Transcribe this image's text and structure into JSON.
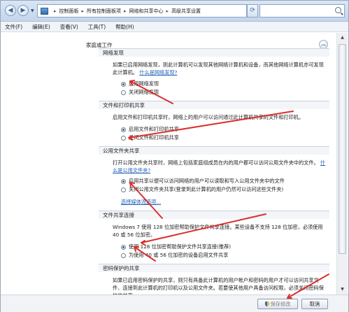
{
  "breadcrumbs": [
    "控制面板",
    "所有控制面板项",
    "网络和共享中心",
    "高级共享设置"
  ],
  "menu": [
    "文件(F)",
    "编辑(E)",
    "查看(V)",
    "工具(T)",
    "帮助(H)"
  ],
  "profile": {
    "title": "家庭或工作",
    "collapse_glyph": "︽"
  },
  "sections": {
    "discovery": {
      "title": "网络发现",
      "desc": "如果已启用网络发现，则此计算机可以发现其他网络计算机和设备，而其他网络计算机亦可发现此计算机。",
      "link": "什么是网络发现?",
      "options": [
        "启用网络发现",
        "关闭网络发现"
      ]
    },
    "file_printer": {
      "title": "文件和打印机共享",
      "desc": "启用文件和打印机共享时，网络上的用户可以访问通过此计算机共享的文件和打印机。",
      "options": [
        "启用文件和打印机共享",
        "关闭文件和打印机共享"
      ]
    },
    "public_folder": {
      "title": "公用文件夹共享",
      "desc": "打开公用文件夹共享时，网络上包括家庭组成员在内的用户都可以访问公用文件夹中的文件。",
      "link": "什么是公用文件夹?",
      "options": [
        "启用共享以便可以访问网络的用户可以读取和写入公用文件夹中的文件",
        "关闭公用文件夹共享(登录到此计算机的用户仍然可以访问这些文件夹)"
      ],
      "media_link": "选择媒体流选项..."
    },
    "connection": {
      "title": "文件共享连接",
      "desc": "Windows 7 使用 128 位加密帮助保护文件共享连接。某些设备不支持 128 位加密，必须使用 40 或 56 位加密。",
      "options": [
        "使用 128 位加密帮助保护文件共享连接(推荐)",
        "为使用 40 或 56 位加密的设备启用文件共享"
      ]
    },
    "password": {
      "title": "密码保护的共享",
      "desc": "如果已启用密码保护的共享，则只有具备此计算机的用户帐户和密码的用户才可以访问共享文件、连接到此计算机的打印机以及公用文件夹。若要使其他用户具备访问权限，必须关闭密码保护的共享。"
    }
  },
  "buttons": {
    "save": "保存修改",
    "cancel": "取消"
  },
  "icons": {
    "back": "◀",
    "forward": "▶",
    "refresh": "⟳",
    "scroll_up": "▲",
    "scroll_down": "▼"
  },
  "colors": {
    "link": "#1f5fb4",
    "annotation_arrow": "#d9302c"
  }
}
